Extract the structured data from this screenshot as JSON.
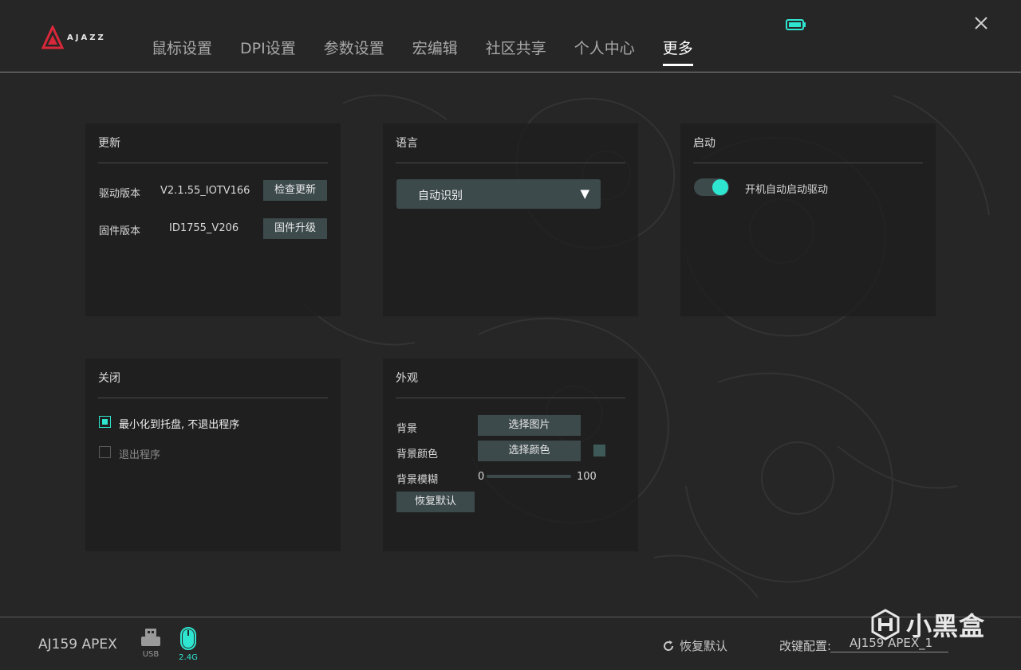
{
  "colors": {
    "accent": "#2ee6d0",
    "button": "#3d4a4c",
    "panel": "#1e1e1e",
    "background": "#262626"
  },
  "brand": {
    "logo_text": "AJAZZ"
  },
  "nav": {
    "items": [
      {
        "label": "鼠标设置"
      },
      {
        "label": "DPI设置"
      },
      {
        "label": "参数设置"
      },
      {
        "label": "宏编辑"
      },
      {
        "label": "社区共享"
      },
      {
        "label": "个人中心"
      },
      {
        "label": "更多",
        "active": true
      }
    ]
  },
  "update": {
    "title": "更新",
    "driver_label": "驱动版本",
    "driver_version": "V2.1.55_IOTV166",
    "check_button": "检查更新",
    "firmware_label": "固件版本",
    "firmware_version": "ID1755_V206",
    "upgrade_button": "固件升级"
  },
  "language": {
    "title": "语言",
    "selected": "自动识别",
    "arrow": "▼"
  },
  "startup": {
    "title": "启动",
    "toggle_label": "开机自动启动驱动",
    "enabled": true
  },
  "close": {
    "title": "关闭",
    "option_minimize": "最小化到托盘, 不退出程序",
    "option_exit": "退出程序",
    "selected": "minimize"
  },
  "appearance": {
    "title": "外观",
    "bg_label": "背景",
    "choose_image": "选择图片",
    "bg_color_label": "背景颜色",
    "choose_color": "选择颜色",
    "swatch_color": "#3d5a58",
    "blur_label": "背景模糊",
    "blur_min": "0",
    "blur_max": "100",
    "reset_button": "恢复默认"
  },
  "footer": {
    "device_name": "AJ159 APEX",
    "usb_label": "USB",
    "wireless_label": "2.4G",
    "reset_label": "恢复默认",
    "profile_label": "改键配置:",
    "profile_value": "AJ159 APEX_1",
    "watermark_text": "小黑盒"
  }
}
